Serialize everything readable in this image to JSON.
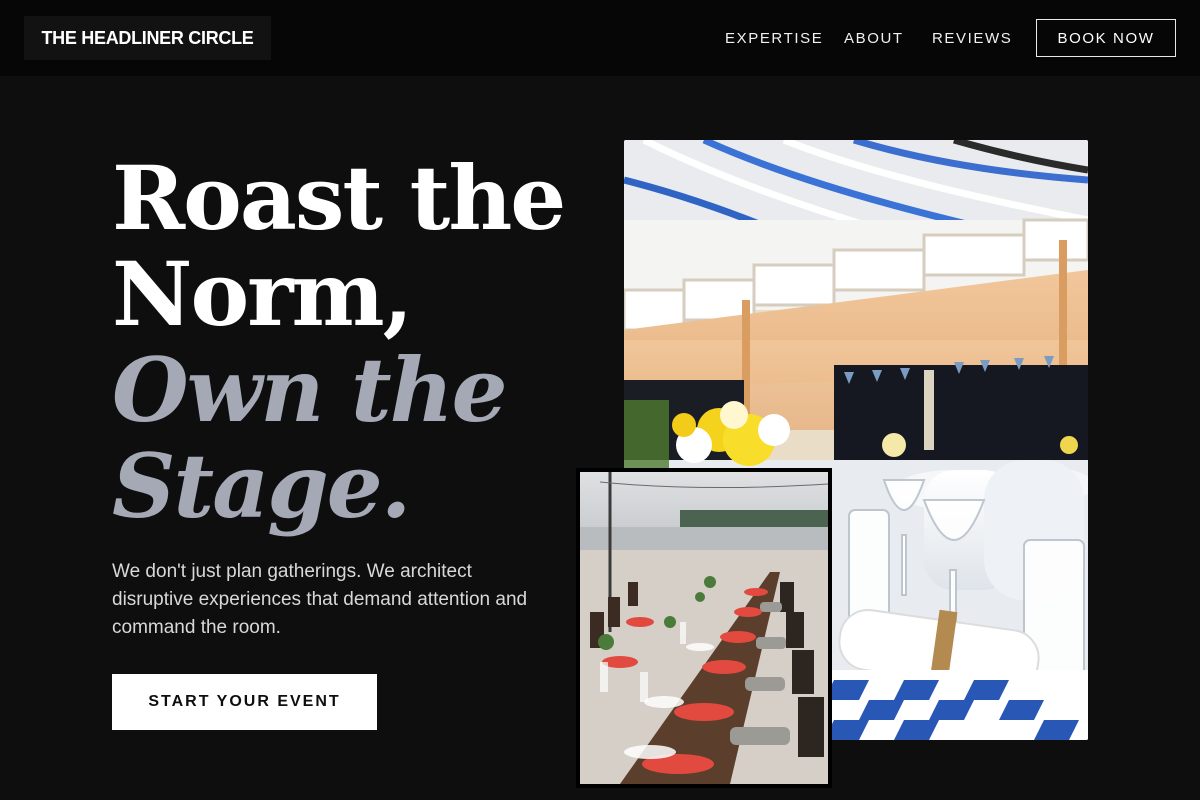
{
  "header": {
    "logo": "THE HEADLINER CIRCLE",
    "nav": [
      {
        "label": "EXPERTISE"
      },
      {
        "label": "ABOUT"
      },
      {
        "label": "REVIEWS"
      }
    ],
    "book_label": "BOOK NOW"
  },
  "hero": {
    "line1": "Roast the",
    "line2": "Norm,",
    "line3": "Own the",
    "line4": "Stage.",
    "subtext": "We don't just plan gatherings. We architect disruptive experiences that demand attention and command the room.",
    "cta_label": "START YOUR EVENT"
  },
  "images": {
    "main": "banquet-hall-photo",
    "secondary": "beach-dinner-table-photo"
  },
  "colors": {
    "background": "#0e0e0e",
    "header_bg": "#060606",
    "headline_white": "#ffffff",
    "headline_muted": "#a4a9b5",
    "cta_bg": "#ffffff"
  }
}
